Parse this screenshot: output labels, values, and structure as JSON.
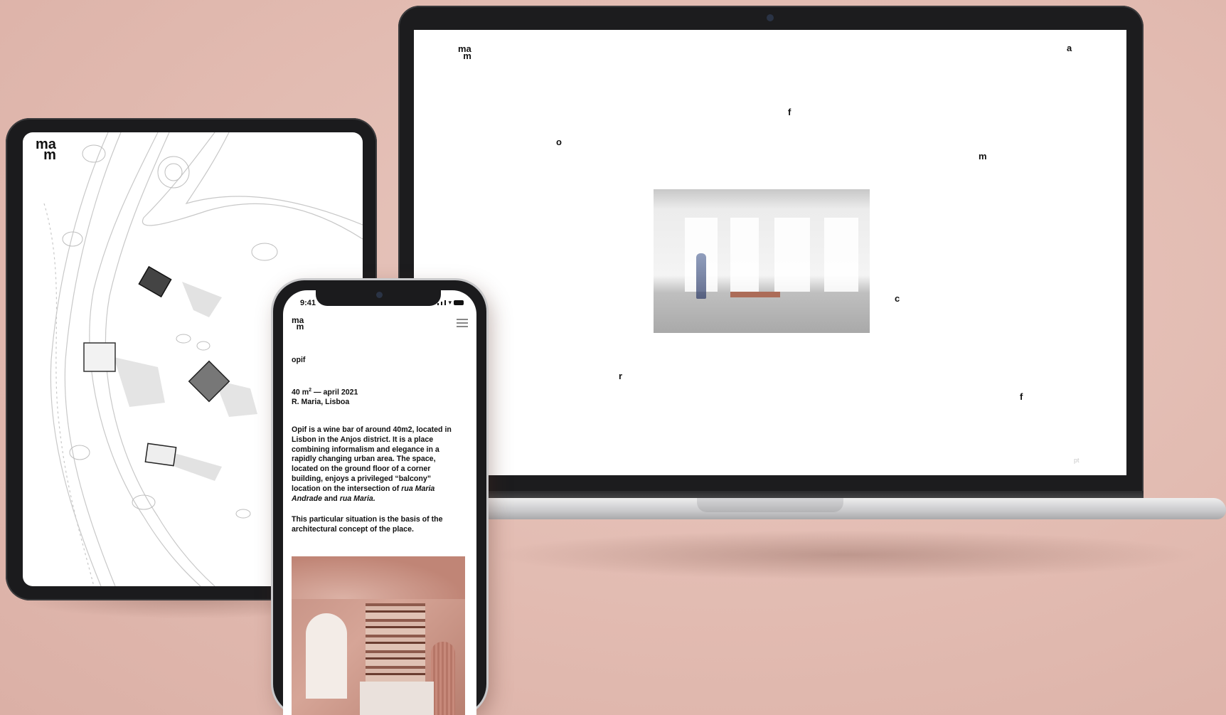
{
  "laptop_site": {
    "logo": {
      "line1": "ma",
      "line2": "m"
    },
    "floating_letters": [
      "a",
      "f",
      "o",
      "m",
      "c",
      "r",
      "f"
    ],
    "lang": "pt"
  },
  "tablet_site": {
    "logo": {
      "line1": "ma",
      "line2": "m"
    }
  },
  "phone_site": {
    "status": {
      "time": "9:41"
    },
    "logo": {
      "line1": "ma",
      "line2": "m"
    },
    "project_title": "opif",
    "area_line": "40 m",
    "area_sup": "2",
    "date_line": " — april 2021",
    "location": "R. Maria, Lisboa",
    "paragraph1_lines": [
      "Opif is a wine bar of around 40m2, located in",
      "Lisbon in the Anjos district. It is a place",
      "combining informalism and elegance in a",
      "rapidly changing urban area. The space,",
      "located on the ground floor of a corner",
      "building, enjoys a privileged “balcony”",
      "location on the intersection of"
    ],
    "paragraph1_italic1": "rua Maria",
    "paragraph1_italic2": "Andrade",
    "paragraph1_and": " and ",
    "paragraph1_italic3": "rua Maria.",
    "paragraph2_lines": [
      "This particular situation is the basis of the",
      "architectural concept of the place."
    ]
  },
  "colors": {
    "background": "#e2bbb1",
    "device_frame": "#1b1b1d",
    "screen": "#ffffff",
    "accent_photo": "#c48f82"
  }
}
